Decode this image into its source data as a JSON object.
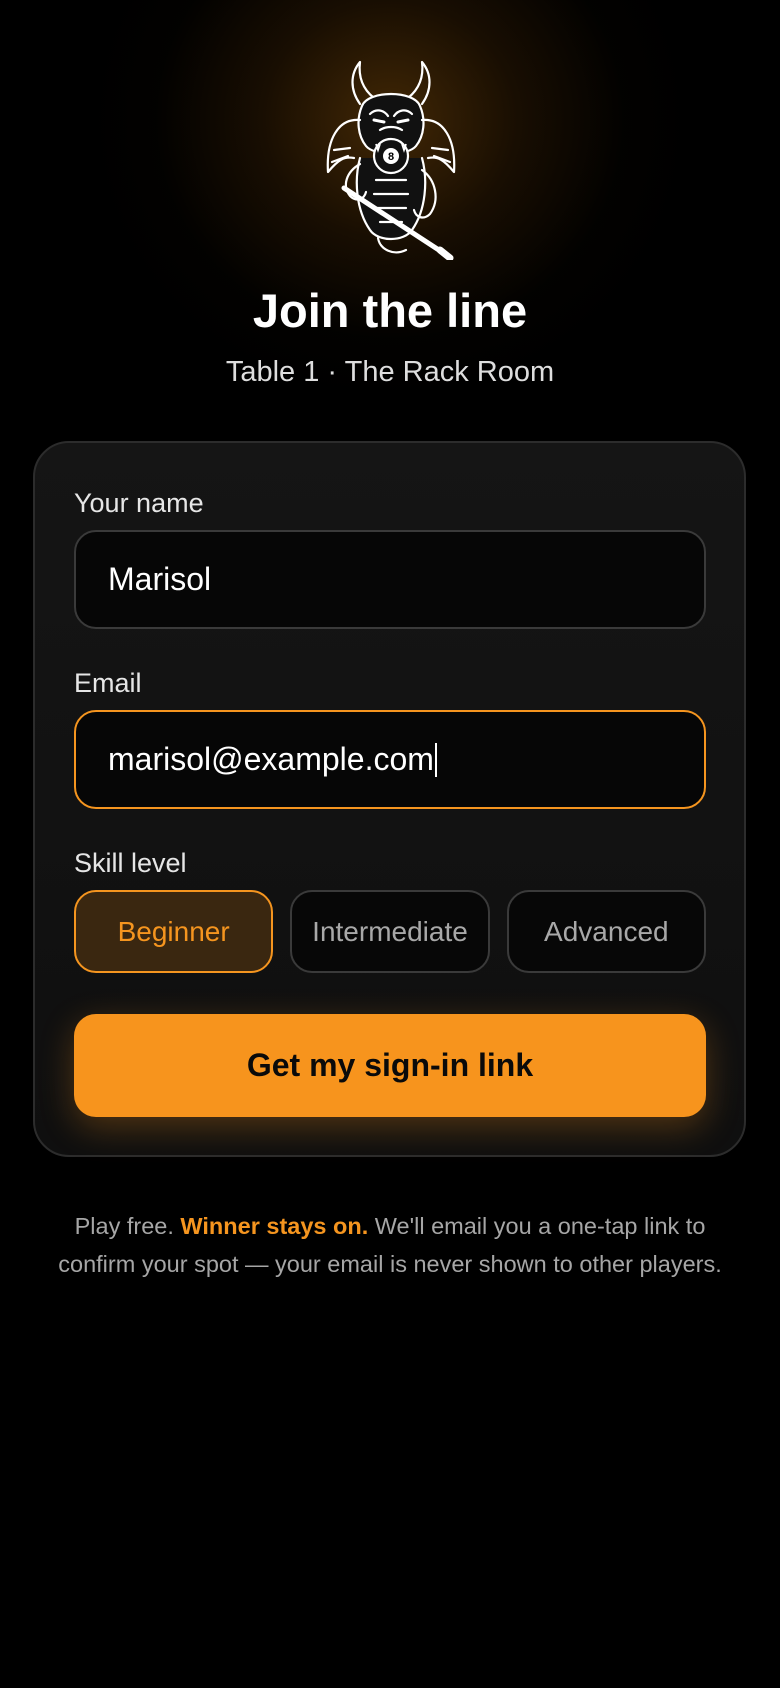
{
  "header": {
    "mascot_icon": "dragon-eight-ball-mascot",
    "title": "Join the line",
    "subtitle": "Table 1 · The Rack Room"
  },
  "form": {
    "name_label": "Your name",
    "name_value": "Marisol",
    "email_label": "Email",
    "email_value": "marisol@example.com",
    "skill_label": "Skill level",
    "skill_options": [
      "Beginner",
      "Intermediate",
      "Advanced"
    ],
    "skill_selected": "Beginner",
    "submit_label": "Get my sign-in link"
  },
  "footer": {
    "lead": "Play free.",
    "highlight": "Winner stays on.",
    "rest": "We'll email you a one-tap link to confirm your spot — your email is never shown to other players."
  },
  "colors": {
    "accent": "#f7941d",
    "background": "#000000",
    "card": "#141414"
  }
}
